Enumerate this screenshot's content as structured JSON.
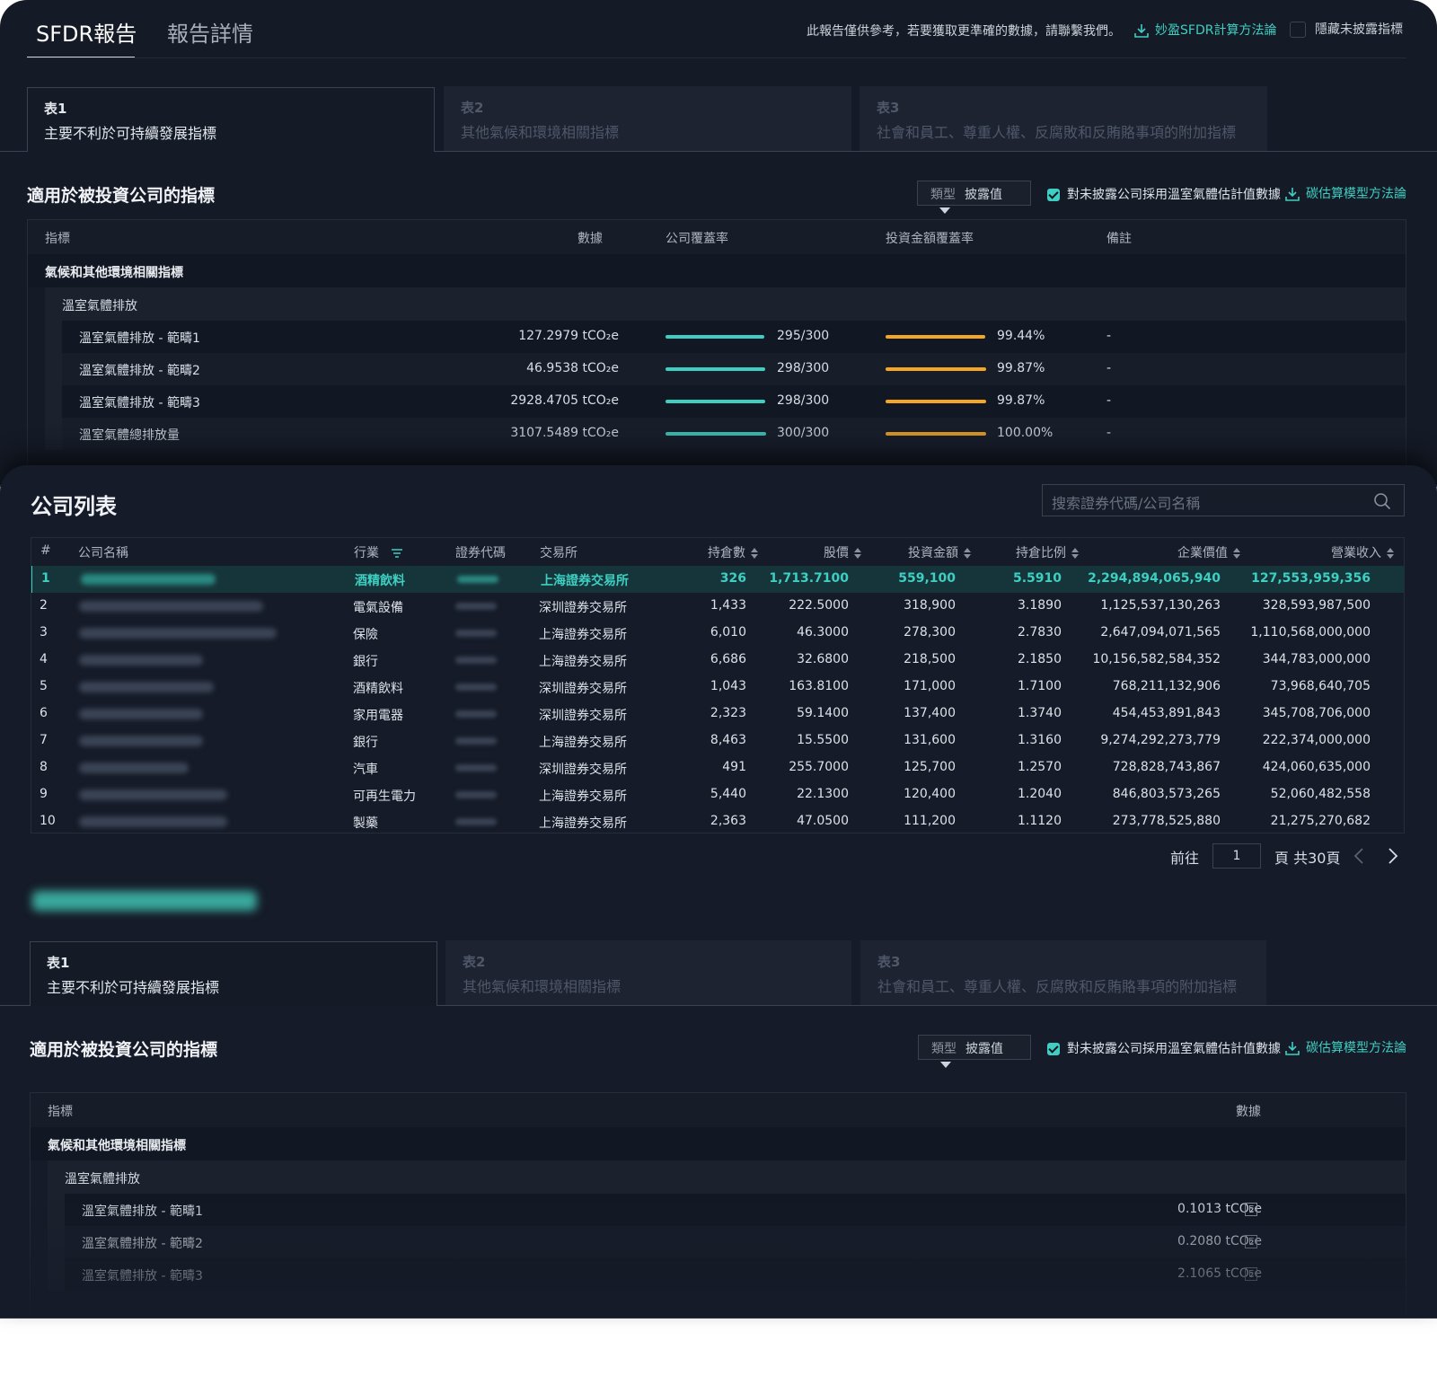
{
  "header": {
    "tab_active": "SFDR報告",
    "tab_inactive": "報告詳情",
    "notice": "此報告僅供參考，若要獲取更準確的數據，請聯繫我們。",
    "method_link": "妙盈SFDR計算方法論",
    "hide_label": "隱藏未披露指標"
  },
  "cards": [
    {
      "num": "表1",
      "desc": "主要不利於可持續發展指標"
    },
    {
      "num": "表2",
      "desc": "其他氣候和環境相關指標"
    },
    {
      "num": "表3",
      "desc": "社會和員工、尊重人權、反腐敗和反賄賂事項的附加指標"
    }
  ],
  "section": {
    "title": "適用於被投資公司的指標",
    "type_label": "類型",
    "type_value": "披露值",
    "estimate_label": "對未披露公司採用溫室氣體估計值數據",
    "carbon_link": "碳估算模型方法論"
  },
  "top_table": {
    "columns": [
      "指標",
      "數據",
      "公司覆蓋率",
      "投資金額覆蓋率",
      "備註"
    ],
    "group": "氣候和其他環境相關指標",
    "subgroup": "溫室氣體排放",
    "rows": [
      {
        "name": "溫室氣體排放 - 範疇1",
        "value": "127.2979 tCO₂e",
        "company": "295/300",
        "company_ratio": 0.983,
        "invest": "99.44%",
        "invest_ratio": 0.9944,
        "note": "-"
      },
      {
        "name": "溫室氣體排放 - 範疇2",
        "value": "46.9538 tCO₂e",
        "company": "298/300",
        "company_ratio": 0.993,
        "invest": "99.87%",
        "invest_ratio": 0.9987,
        "note": "-"
      },
      {
        "name": "溫室氣體排放 - 範疇3",
        "value": "2928.4705 tCO₂e",
        "company": "298/300",
        "company_ratio": 0.993,
        "invest": "99.87%",
        "invest_ratio": 0.9987,
        "note": "-"
      },
      {
        "name": "溫室氣體總排放量",
        "value": "3107.5489 tCO₂e",
        "company": "300/300",
        "company_ratio": 1.0,
        "invest": "100.00%",
        "invest_ratio": 1.0,
        "note": "-"
      }
    ]
  },
  "company_list": {
    "title": "公司列表",
    "search_placeholder": "搜索證券代碼/公司名稱",
    "columns": [
      "#",
      "公司名稱",
      "行業",
      "證券代碼",
      "交易所",
      "持倉數",
      "股價",
      "投資金額",
      "持倉比例",
      "企業價值",
      "營業收入"
    ],
    "rows": [
      {
        "no": "1",
        "industry": "酒精飲料",
        "exchange": "上海證券交易所",
        "shares": "326",
        "price": "1,713.7100",
        "amount": "559,100",
        "ratio": "5.5910",
        "ev": "2,294,894,065,940",
        "revenue": "127,553,959,356"
      },
      {
        "no": "2",
        "industry": "電氣設備",
        "exchange": "深圳證券交易所",
        "shares": "1,433",
        "price": "222.5000",
        "amount": "318,900",
        "ratio": "3.1890",
        "ev": "1,125,537,130,263",
        "revenue": "328,593,987,500"
      },
      {
        "no": "3",
        "industry": "保險",
        "exchange": "上海證券交易所",
        "shares": "6,010",
        "price": "46.3000",
        "amount": "278,300",
        "ratio": "2.7830",
        "ev": "2,647,094,071,565",
        "revenue": "1,110,568,000,000"
      },
      {
        "no": "4",
        "industry": "銀行",
        "exchange": "上海證券交易所",
        "shares": "6,686",
        "price": "32.6800",
        "amount": "218,500",
        "ratio": "2.1850",
        "ev": "10,156,582,584,352",
        "revenue": "344,783,000,000"
      },
      {
        "no": "5",
        "industry": "酒精飲料",
        "exchange": "深圳證券交易所",
        "shares": "1,043",
        "price": "163.8100",
        "amount": "171,000",
        "ratio": "1.7100",
        "ev": "768,211,132,906",
        "revenue": "73,968,640,705"
      },
      {
        "no": "6",
        "industry": "家用電器",
        "exchange": "深圳證券交易所",
        "shares": "2,323",
        "price": "59.1400",
        "amount": "137,400",
        "ratio": "1.3740",
        "ev": "454,453,891,843",
        "revenue": "345,708,706,000"
      },
      {
        "no": "7",
        "industry": "銀行",
        "exchange": "上海證券交易所",
        "shares": "8,463",
        "price": "15.5500",
        "amount": "131,600",
        "ratio": "1.3160",
        "ev": "9,274,292,273,779",
        "revenue": "222,374,000,000"
      },
      {
        "no": "8",
        "industry": "汽車",
        "exchange": "深圳證券交易所",
        "shares": "491",
        "price": "255.7000",
        "amount": "125,700",
        "ratio": "1.2570",
        "ev": "728,828,743,867",
        "revenue": "424,060,635,000"
      },
      {
        "no": "9",
        "industry": "可再生電力",
        "exchange": "上海證券交易所",
        "shares": "5,440",
        "price": "22.1300",
        "amount": "120,400",
        "ratio": "1.2040",
        "ev": "846,803,573,265",
        "revenue": "52,060,482,558"
      },
      {
        "no": "10",
        "industry": "製藥",
        "exchange": "上海證券交易所",
        "shares": "2,363",
        "price": "47.0500",
        "amount": "111,200",
        "ratio": "1.1120",
        "ev": "273,778,525,880",
        "revenue": "21,275,270,682"
      }
    ],
    "pagination": {
      "goto": "前往",
      "page": "1",
      "suffix": "頁 共30頁"
    }
  },
  "detail_table": {
    "columns": [
      "指標",
      "數據"
    ],
    "group": "氣候和其他環境相關指標",
    "subgroup": "溫室氣體排放",
    "estimate_badge": "E",
    "rows": [
      {
        "name": "溫室氣體排放 - 範疇1",
        "value": "0.1013 tCO₂e"
      },
      {
        "name": "溫室氣體排放 - 範疇2",
        "value": "0.2080 tCO₂e"
      },
      {
        "name": "溫室氣體排放 - 範疇3",
        "value": "2.1065 tCO₂e"
      }
    ]
  },
  "colors": {
    "accent": "#3ecfc2",
    "orange": "#f5a623",
    "bg": "#141a26"
  }
}
